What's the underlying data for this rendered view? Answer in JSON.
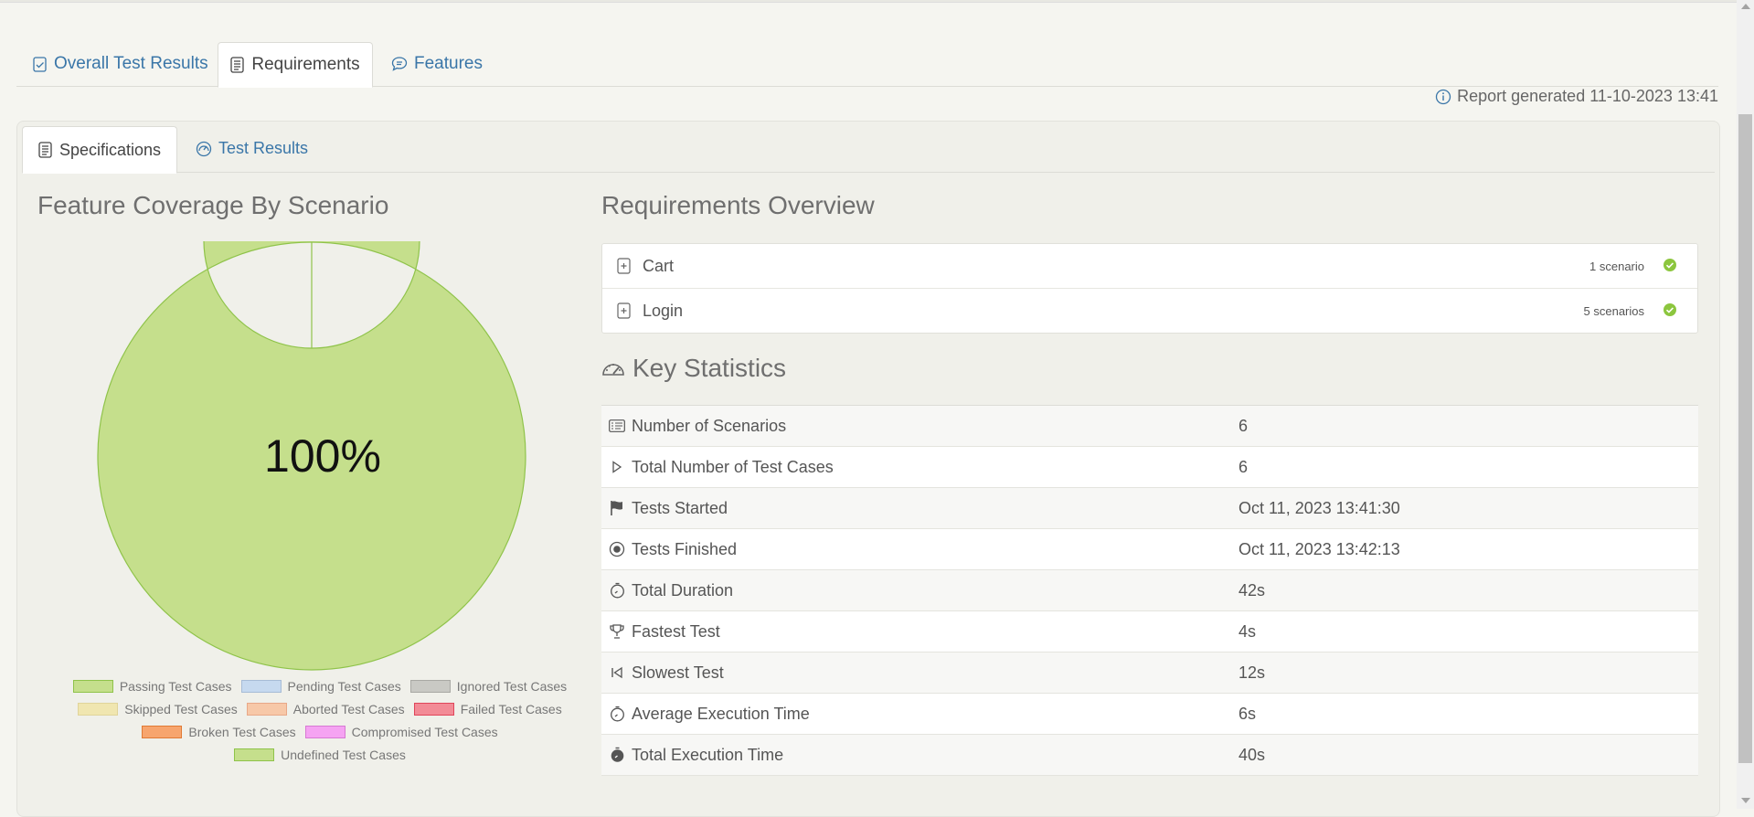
{
  "outer_tabs": [
    {
      "label": "Overall Test Results",
      "icon": "checklist-icon"
    },
    {
      "label": "Requirements",
      "icon": "document-icon"
    },
    {
      "label": "Features",
      "icon": "comment-icon"
    }
  ],
  "report_generated": "Report generated 11-10-2023 13:41",
  "inner_tabs": [
    {
      "label": "Specifications",
      "icon": "document-icon"
    },
    {
      "label": "Test Results",
      "icon": "dashboard-icon"
    }
  ],
  "coverage": {
    "title": "Feature Coverage By Scenario",
    "center_label": "100%"
  },
  "chart_data": {
    "type": "pie",
    "title": "Feature Coverage By Scenario",
    "categories": [
      "Passing Test Cases",
      "Pending Test Cases",
      "Ignored Test Cases",
      "Skipped Test Cases",
      "Aborted Test Cases",
      "Failed Test Cases",
      "Broken Test Cases",
      "Compromised Test Cases",
      "Undefined Test Cases"
    ],
    "values": [
      100,
      0,
      0,
      0,
      0,
      0,
      0,
      0,
      0
    ],
    "colors": [
      "#c5df8c",
      "#c6d9ef",
      "#c9c9c4",
      "#f0e6b0",
      "#f7c8a8",
      "#f28b96",
      "#f7a56e",
      "#f5a3f2",
      "#c5df8c"
    ],
    "borders": [
      "#8fc34a",
      "#a7bcd6",
      "#a9a9a4",
      "#e0d49a",
      "#e8a888",
      "#e0455a",
      "#e07a35",
      "#d77ad3",
      "#8fc34a"
    ],
    "legend_position": "bottom"
  },
  "requirements": {
    "title": "Requirements Overview",
    "items": [
      {
        "name": "Cart",
        "count": "1 scenario"
      },
      {
        "name": "Login",
        "count": "5 scenarios"
      }
    ]
  },
  "stats": {
    "title": "Key Statistics",
    "rows": [
      {
        "label": "Number of Scenarios",
        "value": "6",
        "icon": "list-icon"
      },
      {
        "label": "Total Number of Test Cases",
        "value": "6",
        "icon": "play-icon"
      },
      {
        "label": "Tests Started",
        "value": "Oct 11, 2023 13:41:30",
        "icon": "flag-icon"
      },
      {
        "label": "Tests Finished",
        "value": "Oct 11, 2023 13:42:13",
        "icon": "stop-circle-icon"
      },
      {
        "label": "Total Duration",
        "value": "42s",
        "icon": "stopwatch-icon"
      },
      {
        "label": "Fastest Test",
        "value": "4s",
        "icon": "trophy-icon"
      },
      {
        "label": "Slowest Test",
        "value": "12s",
        "icon": "rewind-icon"
      },
      {
        "label": "Average Execution Time",
        "value": "6s",
        "icon": "stopwatch-icon"
      },
      {
        "label": "Total Execution Time",
        "value": "40s",
        "icon": "stopwatch-filled-icon"
      }
    ]
  }
}
